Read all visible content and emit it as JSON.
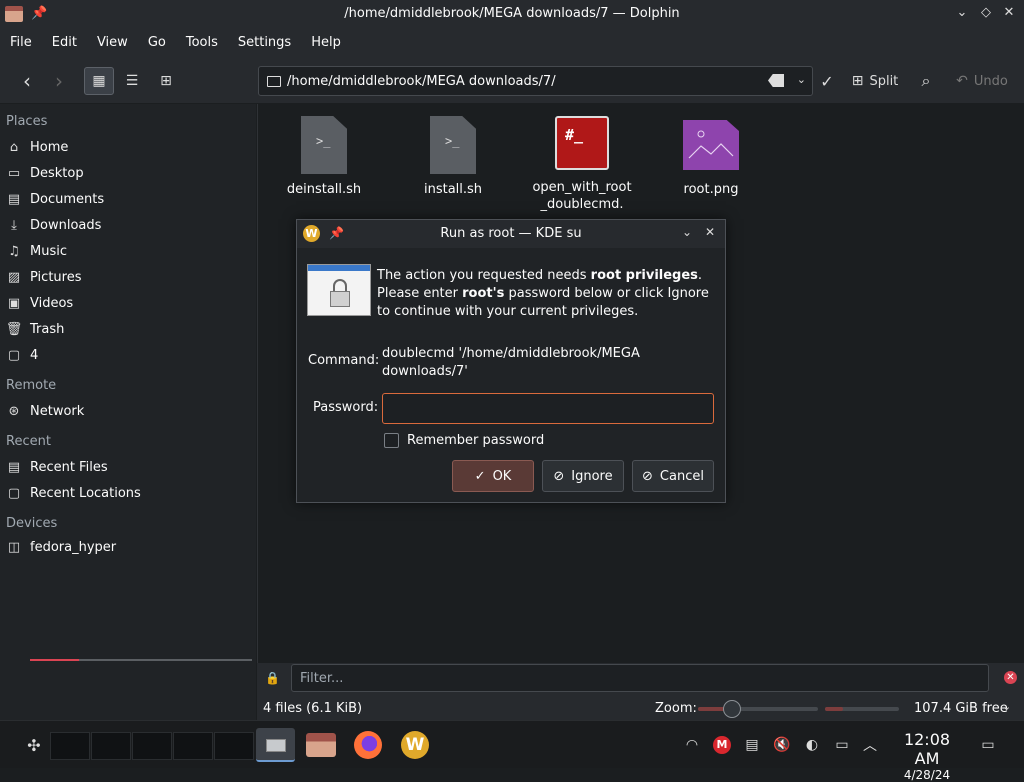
{
  "window": {
    "title": "/home/dmiddlebrook/MEGA downloads/7 — Dolphin",
    "buttons": {
      "minimize": "⌄",
      "maximize": "◇",
      "close": "✕"
    }
  },
  "menu": [
    "File",
    "Edit",
    "View",
    "Go",
    "Tools",
    "Settings",
    "Help"
  ],
  "toolbar": {
    "location_path": "/home/dmiddlebrook/MEGA downloads/7/",
    "split_label": "Split",
    "undo_label": "Undo"
  },
  "sidebar": {
    "places_heading": "Places",
    "places": [
      {
        "label": "Home",
        "icon": "home-icon"
      },
      {
        "label": "Desktop",
        "icon": "desktop-icon"
      },
      {
        "label": "Documents",
        "icon": "documents-icon"
      },
      {
        "label": "Downloads",
        "icon": "downloads-icon"
      },
      {
        "label": "Music",
        "icon": "music-icon"
      },
      {
        "label": "Pictures",
        "icon": "pictures-icon"
      },
      {
        "label": "Videos",
        "icon": "videos-icon"
      },
      {
        "label": "Trash",
        "icon": "trash-icon"
      },
      {
        "label": "4",
        "icon": "folder-icon"
      }
    ],
    "remote_heading": "Remote",
    "remote": [
      {
        "label": "Network",
        "icon": "network-icon"
      }
    ],
    "recent_heading": "Recent",
    "recent": [
      {
        "label": "Recent Files",
        "icon": "recent-files-icon"
      },
      {
        "label": "Recent Locations",
        "icon": "recent-locations-icon"
      }
    ],
    "devices_heading": "Devices",
    "devices": [
      {
        "label": "fedora_hyper",
        "icon": "drive-icon",
        "usage_fraction": 0.22
      }
    ]
  },
  "files": [
    {
      "name": "deinstall.sh",
      "kind": "shell-script-icon"
    },
    {
      "name": "install.sh",
      "kind": "shell-script-icon"
    },
    {
      "name": "open_with_root_doublecmd.",
      "kind": "root-terminal-icon"
    },
    {
      "name": "root.png",
      "kind": "image-file-icon"
    }
  ],
  "filter": {
    "placeholder": "Filter..."
  },
  "status": {
    "count": "4 files (6.1 KiB)",
    "zoom_label": "Zoom:",
    "zoom_fraction": 0.28,
    "free_space": "107.4 GiB free"
  },
  "dialog": {
    "title": "Run as root — KDE su",
    "msg_1": "The action you requested needs ",
    "msg_bold_1": "root privileges",
    "msg_2": ".",
    "msg_3": "Please enter ",
    "msg_bold_2": "root's",
    "msg_4": " password below or click Ignore to continue with your current privileges.",
    "command_label": "Command:",
    "command_value": "doublecmd '/home/dmiddlebrook/MEGA downloads/7'",
    "password_label": "Password:",
    "password_value": "",
    "remember_label": "Remember password",
    "ok_label": "OK",
    "ignore_label": "Ignore",
    "cancel_label": "Cancel"
  },
  "taskbar": {
    "time": "12:08 AM",
    "date": "4/28/24"
  }
}
